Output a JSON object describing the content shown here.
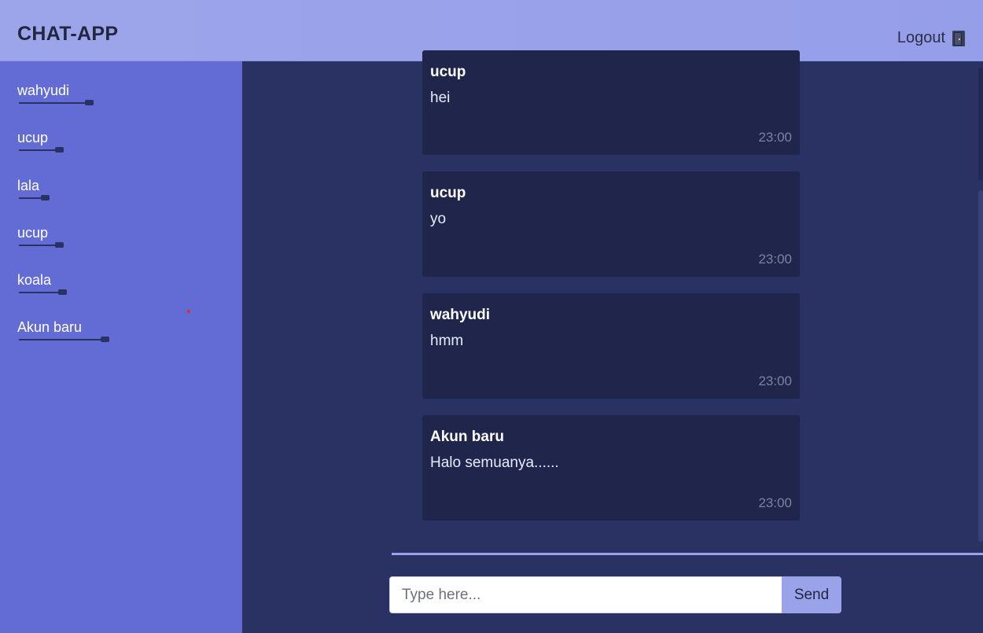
{
  "app": {
    "title": "CHAT-APP",
    "logout_label": "Logout",
    "logout_icon": "door-icon"
  },
  "sidebar": {
    "users": [
      {
        "name": "wahyudi"
      },
      {
        "name": "ucup"
      },
      {
        "name": "lala"
      },
      {
        "name": "ucup"
      },
      {
        "name": "koala"
      },
      {
        "name": "Akun baru"
      }
    ]
  },
  "messages": [
    {
      "sender": "ucup",
      "text": "hei",
      "time": "23:00"
    },
    {
      "sender": "ucup",
      "text": "yo",
      "time": "23:00"
    },
    {
      "sender": "wahyudi",
      "text": "hmm",
      "time": "23:00"
    },
    {
      "sender": "Akun baru",
      "text": "Halo semuanya......",
      "time": "23:00"
    }
  ],
  "composer": {
    "placeholder": "Type here...",
    "value": "",
    "send_label": "Send"
  },
  "colors": {
    "header": "#9aa2ea",
    "sidebar": "#626cd4",
    "chat_bg": "#293262",
    "bubble": "#20264b"
  }
}
